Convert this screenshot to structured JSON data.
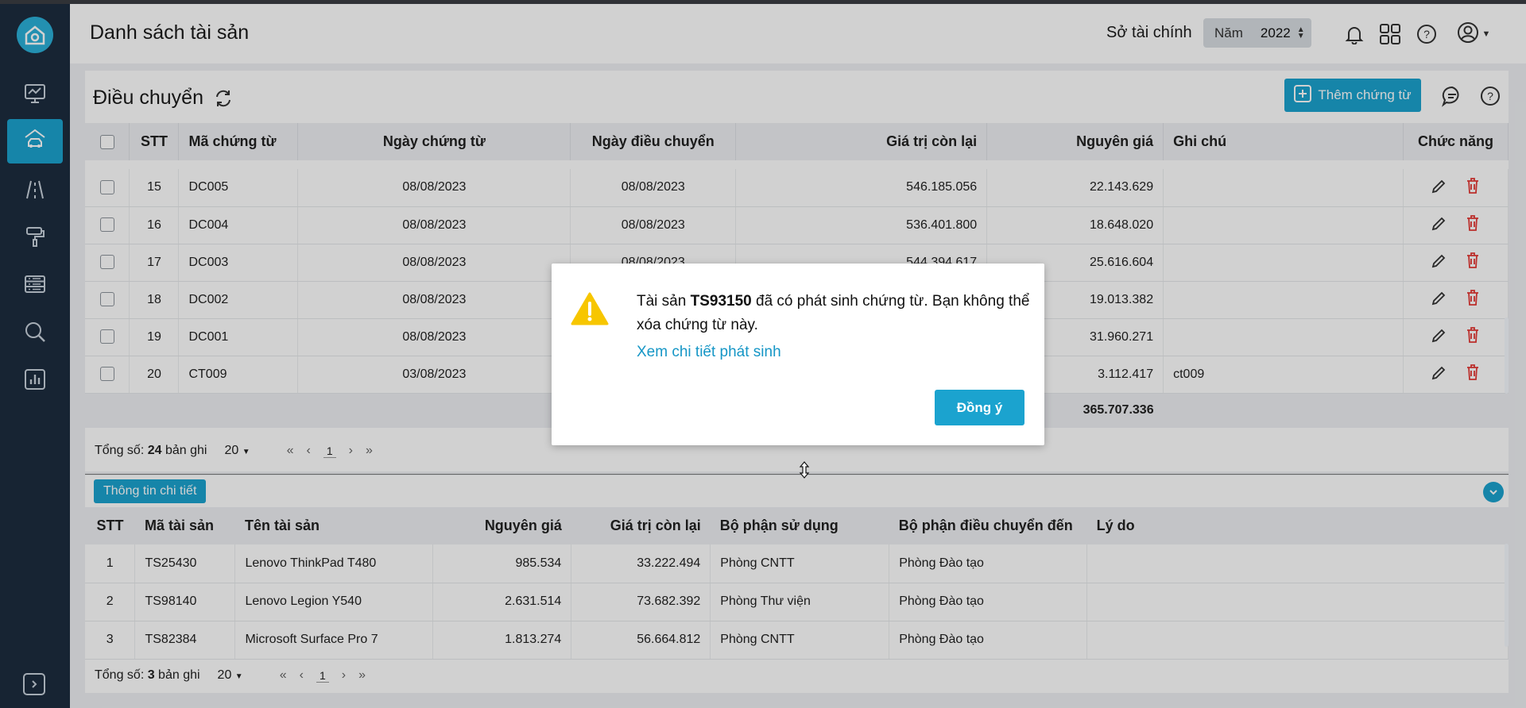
{
  "header": {
    "title": "Danh sách tài sản",
    "org": "Sở tài chính",
    "year_label": "Năm",
    "year_value": "2022"
  },
  "card": {
    "title": "Điều chuyển",
    "add_button": "Thêm chứng từ"
  },
  "table": {
    "columns": [
      "STT",
      "Mã chứng từ",
      "Ngày chứng từ",
      "Ngày điều chuyển",
      "Giá trị còn lại",
      "Nguyên giá",
      "Ghi chú",
      "Chức năng"
    ],
    "rows": [
      {
        "stt": "15",
        "code": "DC005",
        "doc_date": "08/08/2023",
        "transfer_date": "08/08/2023",
        "remaining": "546.185.056",
        "original": "22.143.629",
        "note": ""
      },
      {
        "stt": "16",
        "code": "DC004",
        "doc_date": "08/08/2023",
        "transfer_date": "08/08/2023",
        "remaining": "536.401.800",
        "original": "18.648.020",
        "note": ""
      },
      {
        "stt": "17",
        "code": "DC003",
        "doc_date": "08/08/2023",
        "transfer_date": "08/08/2023",
        "remaining": "544.394.617",
        "original": "25.616.604",
        "note": ""
      },
      {
        "stt": "18",
        "code": "DC002",
        "doc_date": "08/08/2023",
        "transfer_date": "",
        "remaining": "",
        "original": "19.013.382",
        "note": ""
      },
      {
        "stt": "19",
        "code": "DC001",
        "doc_date": "08/08/2023",
        "transfer_date": "",
        "remaining": "",
        "original": "31.960.271",
        "note": ""
      },
      {
        "stt": "20",
        "code": "CT009",
        "doc_date": "03/08/2023",
        "transfer_date": "",
        "remaining": "",
        "original": "3.112.417",
        "note": "ct009"
      }
    ],
    "total_original": "365.707.336"
  },
  "pager1": {
    "total_prefix": "Tổng số: ",
    "total_count": "24",
    "total_suffix": " bản ghi",
    "page_size": "20",
    "page": "1"
  },
  "detail": {
    "badge": "Thông tin chi tiết",
    "columns": [
      "STT",
      "Mã tài sản",
      "Tên tài sản",
      "Nguyên giá",
      "Giá trị còn lại",
      "Bộ phận sử dụng",
      "Bộ phận điều chuyển đến",
      "Lý do"
    ],
    "rows": [
      {
        "stt": "1",
        "code": "TS25430",
        "name": "Lenovo ThinkPad T480",
        "original": "985.534",
        "remaining": "33.222.494",
        "dept": "Phòng CNTT",
        "to_dept": "Phòng Đào tạo",
        "reason": ""
      },
      {
        "stt": "2",
        "code": "TS98140",
        "name": "Lenovo Legion Y540",
        "original": "2.631.514",
        "remaining": "73.682.392",
        "dept": "Phòng Thư viện",
        "to_dept": "Phòng Đào tạo",
        "reason": ""
      },
      {
        "stt": "3",
        "code": "TS82384",
        "name": "Microsoft Surface Pro 7",
        "original": "1.813.274",
        "remaining": "56.664.812",
        "dept": "Phòng CNTT",
        "to_dept": "Phòng Đào tạo",
        "reason": ""
      }
    ]
  },
  "pager2": {
    "total_prefix": "Tổng số: ",
    "total_count": "3",
    "total_suffix": " bản ghi",
    "page_size": "20",
    "page": "1"
  },
  "dialog": {
    "msg_pre": "Tài sản ",
    "asset": "TS93150",
    "msg_post": " đã có phát sinh chứng từ. Bạn không thể xóa chứng từ này.",
    "link": "Xem chi tiết phát sinh",
    "ok": "Đồng ý"
  },
  "colors": {
    "accent": "#1ba3cf",
    "sidebar": "#1d2c3f",
    "danger": "#e53935",
    "warning": "#f7c600"
  },
  "icons": [
    "home-logo-icon",
    "monitor-chart-icon",
    "car-building-icon",
    "road-icon",
    "paint-roller-icon",
    "server-list-icon",
    "search-icon",
    "bar-chart-icon",
    "bell-icon",
    "apps-grid-icon",
    "help-icon",
    "user-icon",
    "refresh-icon",
    "plus-icon",
    "comment-icon",
    "pencil-icon",
    "trash-icon",
    "warning-icon",
    "chevron-down-icon",
    "expand-sidebar-icon"
  ]
}
